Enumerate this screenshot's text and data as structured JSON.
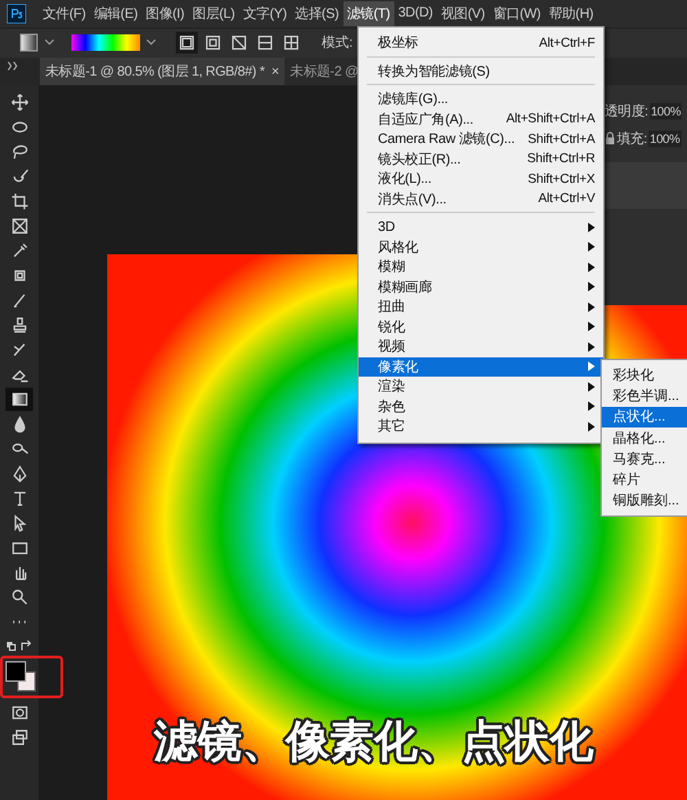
{
  "menu_bar": [
    {
      "label": "文件(F)",
      "selected": false
    },
    {
      "label": "编辑(E)",
      "selected": false
    },
    {
      "label": "图像(I)",
      "selected": false
    },
    {
      "label": "图层(L)",
      "selected": false
    },
    {
      "label": "文字(Y)",
      "selected": false
    },
    {
      "label": "选择(S)",
      "selected": false
    },
    {
      "label": "滤镜(T)",
      "selected": true
    },
    {
      "label": "3D(D)",
      "selected": false
    },
    {
      "label": "视图(V)",
      "selected": false
    },
    {
      "label": "窗口(W)",
      "selected": false
    },
    {
      "label": "帮助(H)",
      "selected": false
    }
  ],
  "options_bar": {
    "gradient_types": [
      {
        "selected": true
      },
      {
        "selected": false
      },
      {
        "selected": false
      },
      {
        "selected": false
      },
      {
        "selected": false
      }
    ],
    "mode_label": "模式:"
  },
  "tabs": [
    {
      "label": "未标题-1 @ 80.5% (图层 1, RGB/8#) *",
      "close": "×",
      "selected": true
    },
    {
      "label": "未标题-2 @",
      "selected": false
    }
  ],
  "tools": [
    {
      "kind": "move",
      "selected": false
    },
    {
      "kind": "marquee",
      "selected": false
    },
    {
      "kind": "lasso",
      "selected": false
    },
    {
      "kind": "quick-select",
      "selected": false
    },
    {
      "kind": "crop",
      "selected": false
    },
    {
      "kind": "frame",
      "selected": false
    },
    {
      "kind": "eyedropper",
      "selected": false
    },
    {
      "kind": "healing",
      "selected": false
    },
    {
      "kind": "brush",
      "selected": false
    },
    {
      "kind": "stamp",
      "selected": false
    },
    {
      "kind": "history-brush",
      "selected": false
    },
    {
      "kind": "eraser",
      "selected": false
    },
    {
      "kind": "gradient",
      "selected": true
    },
    {
      "kind": "blur",
      "selected": false
    },
    {
      "kind": "dodge",
      "selected": false
    },
    {
      "kind": "pen",
      "selected": false
    },
    {
      "kind": "type",
      "selected": false
    },
    {
      "kind": "path-select",
      "selected": false
    },
    {
      "kind": "rectangle",
      "selected": false
    },
    {
      "kind": "hand",
      "selected": false
    },
    {
      "kind": "zoom",
      "selected": false
    },
    {
      "kind": "more",
      "selected": false
    }
  ],
  "extra_tools": [
    {
      "kind": "quickmask"
    },
    {
      "kind": "screen-mode"
    }
  ],
  "layers_panel": {
    "opacity_label": "透明度:",
    "opacity": "100%",
    "fill_label": "填充:",
    "fill": "100%"
  },
  "filter_menu": {
    "items": [
      {
        "kind": "item",
        "label": "极坐标",
        "shortcut": "Alt+Ctrl+F",
        "submenu": false,
        "selected": false
      },
      {
        "kind": "separator"
      },
      {
        "kind": "item",
        "label": "转换为智能滤镜(S)",
        "submenu": false,
        "selected": false
      },
      {
        "kind": "separator"
      },
      {
        "kind": "item",
        "label": "滤镜库(G)...",
        "submenu": false,
        "selected": false
      },
      {
        "kind": "item",
        "label": "自适应广角(A)...",
        "shortcut": "Alt+Shift+Ctrl+A",
        "submenu": false,
        "selected": false
      },
      {
        "kind": "item",
        "label": "Camera Raw 滤镜(C)...",
        "shortcut": "Shift+Ctrl+A",
        "submenu": false,
        "selected": false
      },
      {
        "kind": "item",
        "label": "镜头校正(R)...",
        "shortcut": "Shift+Ctrl+R",
        "submenu": false,
        "selected": false
      },
      {
        "kind": "item",
        "label": "液化(L)...",
        "shortcut": "Shift+Ctrl+X",
        "submenu": false,
        "selected": false
      },
      {
        "kind": "item",
        "label": "消失点(V)...",
        "shortcut": "Alt+Ctrl+V",
        "submenu": false,
        "selected": false
      },
      {
        "kind": "separator"
      },
      {
        "kind": "item",
        "label": "3D",
        "submenu": true,
        "selected": false
      },
      {
        "kind": "item",
        "label": "风格化",
        "submenu": true,
        "selected": false
      },
      {
        "kind": "item",
        "label": "模糊",
        "submenu": true,
        "selected": false
      },
      {
        "kind": "item",
        "label": "模糊画廊",
        "submenu": true,
        "selected": false
      },
      {
        "kind": "item",
        "label": "扭曲",
        "submenu": true,
        "selected": false
      },
      {
        "kind": "item",
        "label": "锐化",
        "submenu": true,
        "selected": false
      },
      {
        "kind": "item",
        "label": "视频",
        "submenu": true,
        "selected": false
      },
      {
        "kind": "item",
        "label": "像素化",
        "submenu": true,
        "selected": true
      },
      {
        "kind": "item",
        "label": "渲染",
        "submenu": true,
        "selected": false
      },
      {
        "kind": "item",
        "label": "杂色",
        "submenu": true,
        "selected": false
      },
      {
        "kind": "item",
        "label": "其它",
        "submenu": true,
        "selected": false
      }
    ]
  },
  "pixelate_submenu": [
    {
      "label": "彩块化",
      "selected": false
    },
    {
      "label": "彩色半调...",
      "selected": false
    },
    {
      "label": "点状化...",
      "selected": true
    },
    {
      "label": "晶格化...",
      "selected": false
    },
    {
      "label": "马赛克...",
      "selected": false
    },
    {
      "label": "碎片",
      "selected": false
    },
    {
      "label": "铜版雕刻...",
      "selected": false
    }
  ],
  "caption": "滤镜、像素化、点状化"
}
